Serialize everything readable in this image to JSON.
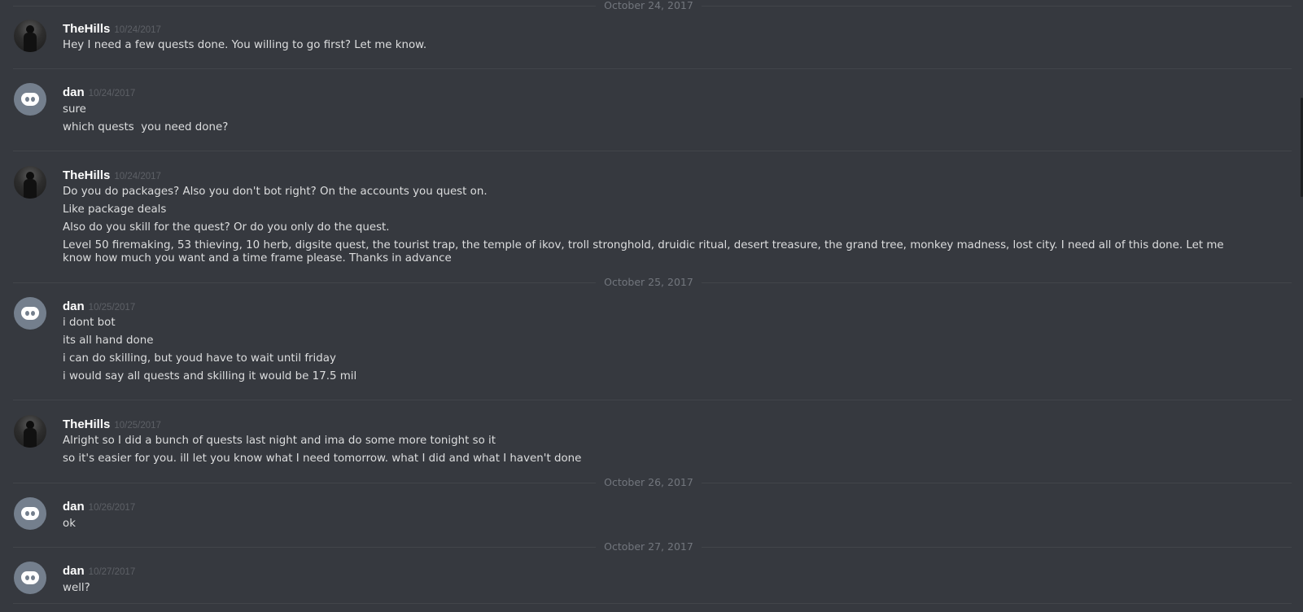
{
  "date_separators": {
    "oct24": "October 24, 2017",
    "oct25": "October 25, 2017",
    "oct26": "October 26, 2017",
    "oct27": "October 27, 2017"
  },
  "messages": [
    {
      "author": "TheHills",
      "timestamp": "10/24/2017",
      "avatar": "user-photo-avatar",
      "lines": [
        "Hey I need a few quests done. You willing to go first? Let me know."
      ]
    },
    {
      "author": "dan",
      "timestamp": "10/24/2017",
      "avatar": "discord-default-avatar",
      "lines": [
        "sure",
        "which quests  you need done?"
      ]
    },
    {
      "author": "TheHills",
      "timestamp": "10/24/2017",
      "avatar": "user-photo-avatar",
      "lines": [
        "Do you do packages? Also you don't bot right? On the accounts you quest on.",
        "Like package deals",
        "Also do you skill for the quest? Or do you only do the quest.",
        "Level 50 firemaking, 53 thieving, 10 herb, digsite quest, the tourist trap, the temple of ikov, troll stronghold, druidic ritual, desert treasure, the grand tree, monkey madness, lost city. I need all of this done. Let me know how much you want and a time frame please. Thanks in advance"
      ]
    },
    {
      "author": "dan",
      "timestamp": "10/25/2017",
      "avatar": "discord-default-avatar",
      "lines": [
        "i dont bot",
        "its all hand done",
        "i can do skilling, but youd have to wait until friday",
        "i would say all quests and skilling it would be 17.5 mil"
      ]
    },
    {
      "author": "TheHills",
      "timestamp": "10/25/2017",
      "avatar": "user-photo-avatar",
      "lines": [
        "Alright so I did a bunch of quests last night and ima do some more tonight so it",
        "so it's easier for you. ill let you know what I need tomorrow. what I did and what I haven't done"
      ]
    },
    {
      "author": "dan",
      "timestamp": "10/26/2017",
      "avatar": "discord-default-avatar",
      "lines": [
        "ok"
      ]
    },
    {
      "author": "dan",
      "timestamp": "10/27/2017",
      "avatar": "discord-default-avatar",
      "lines": [
        "well?"
      ]
    }
  ],
  "colors": {
    "background": "#36393f",
    "username": "#ffffff",
    "message_text": "#dcddde",
    "timestamp": "#5d6066",
    "divider": "#42454a",
    "date_label": "#72767d",
    "discord_avatar": "#747f8d"
  }
}
